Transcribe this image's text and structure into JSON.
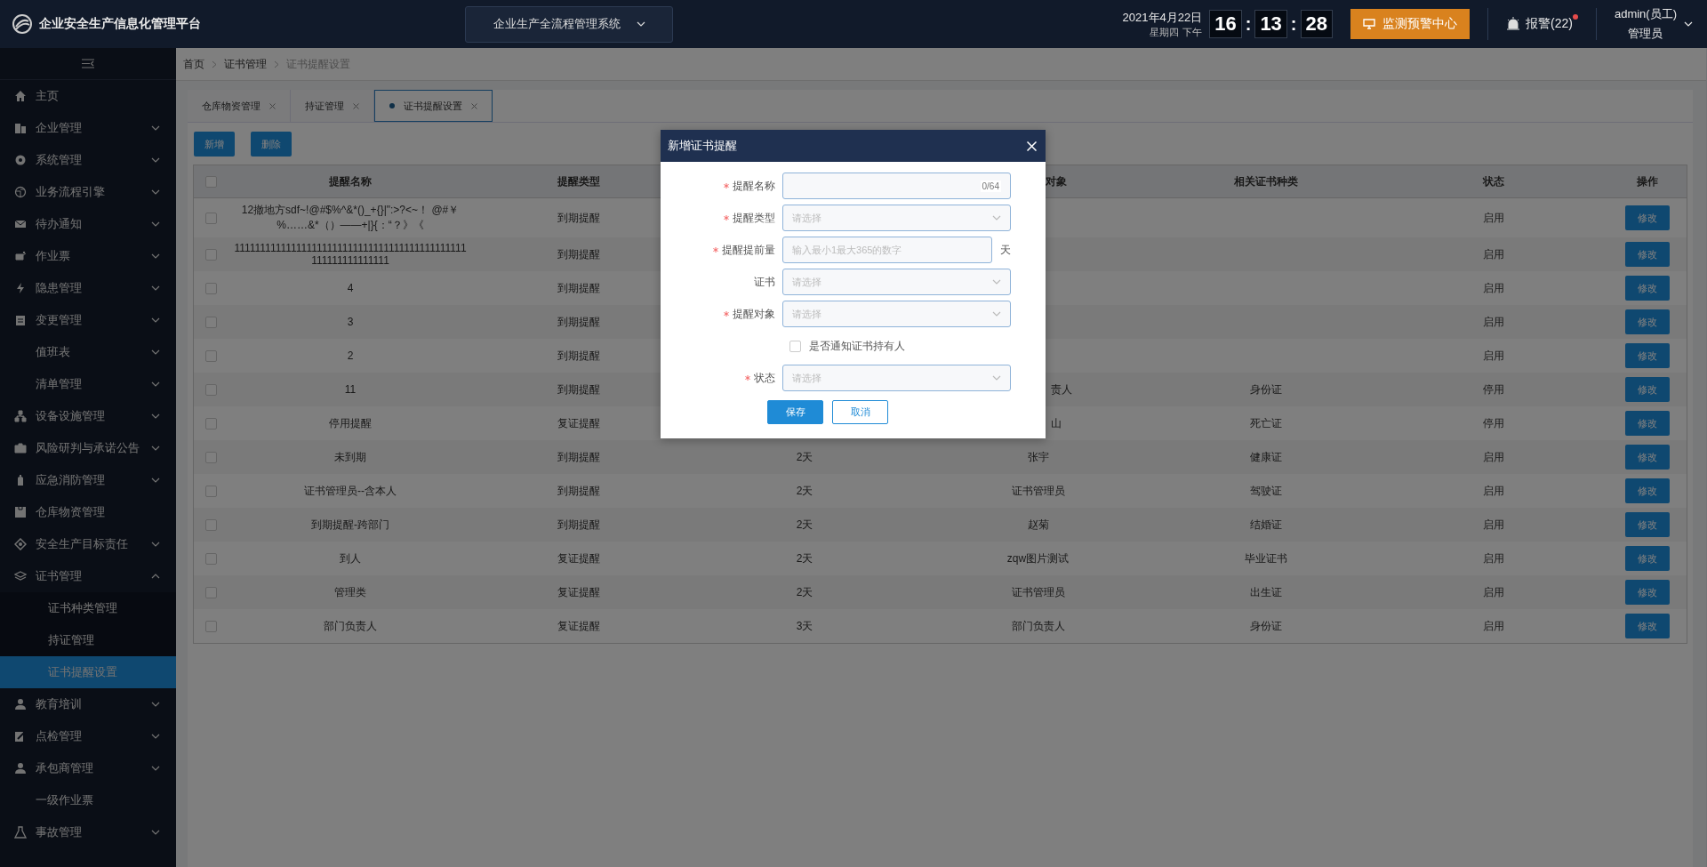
{
  "header": {
    "title": "企业安全生产信息化管理平台",
    "system": "企业生产全流程管理系统",
    "date": "2021年4月22日",
    "weekday": "星期四",
    "period": "下午",
    "time": [
      "16",
      "13",
      "28"
    ],
    "time_separators": [
      ":",
      ":"
    ],
    "monitor_button": "监测预警中心",
    "alarm": {
      "label": "报警(22)",
      "unread": true
    },
    "user": {
      "name": "admin(员工)",
      "role": "管理员"
    }
  },
  "sidebar": {
    "items": [
      {
        "label": "主页",
        "selected": false
      },
      {
        "label": "企业管理",
        "expanded": false,
        "selected": false
      },
      {
        "label": "系统管理",
        "expanded": false,
        "selected": false
      },
      {
        "label": "业务流程引擎",
        "expanded": false,
        "selected": false
      },
      {
        "label": "待办通知",
        "expanded": false,
        "selected": false
      },
      {
        "label": "作业票",
        "expanded": false,
        "selected": false
      },
      {
        "label": "隐患管理",
        "expanded": false,
        "selected": false
      },
      {
        "label": "变更管理",
        "expanded": false,
        "selected": false
      },
      {
        "label": "值班表",
        "expanded": false,
        "selected": false
      },
      {
        "label": "清单管理",
        "expanded": false,
        "selected": false
      },
      {
        "label": "设备设施管理",
        "expanded": false,
        "selected": false
      },
      {
        "label": "风险研判与承诺公告",
        "expanded": false,
        "selected": false
      },
      {
        "label": "应急消防管理",
        "expanded": false,
        "selected": false
      },
      {
        "label": "仓库物资管理",
        "selected": false
      },
      {
        "label": "安全生产目标责任",
        "expanded": false,
        "selected": false
      },
      {
        "label": "证书管理",
        "expanded": true,
        "selected": false,
        "children": [
          {
            "label": "证书种类管理",
            "selected": false
          },
          {
            "label": "持证管理",
            "selected": false
          },
          {
            "label": "证书提醒设置",
            "selected": true
          }
        ]
      },
      {
        "label": "教育培训",
        "expanded": false,
        "selected": false
      },
      {
        "label": "点检管理",
        "expanded": false,
        "selected": false
      },
      {
        "label": "承包商管理",
        "expanded": false,
        "selected": false
      },
      {
        "label": "一级作业票",
        "selected": false
      },
      {
        "label": "事故管理",
        "expanded": false,
        "selected": false
      }
    ]
  },
  "breadcrumb": [
    {
      "label": "首页",
      "current": false
    },
    {
      "label": "证书管理",
      "current": false
    },
    {
      "label": "证书提醒设置",
      "current": true
    }
  ],
  "tabs": [
    {
      "label": "仓库物资管理",
      "selected": false
    },
    {
      "label": "持证管理",
      "selected": false
    },
    {
      "label": "证书提醒设置",
      "selected": true
    }
  ],
  "toolbar": [
    "新增",
    "删除"
  ],
  "table": {
    "header_checked": false,
    "columns": [
      {
        "label": "提醒名称"
      },
      {
        "label": "提醒类型"
      },
      {
        "label": "对象",
        "partial": true
      },
      {
        "label": "相关证书种类"
      },
      {
        "label": "状态"
      },
      {
        "label": "操作"
      }
    ],
    "rows": [
      {
        "checked": false,
        "name": "12撤地方sdf~!@#$%^&*()_+{}|\":>?<~！ @#￥%……&*（）——+|}{：“？》《",
        "type": "到期提醒",
        "status": "启用",
        "action": "修改"
      },
      {
        "checked": false,
        "name": "111111111111111111111111111111111111111111111111111111111111",
        "type": "到期提醒",
        "status": "启用",
        "action": "修改"
      },
      {
        "checked": false,
        "name": "4",
        "type": "到期提醒",
        "status": "启用",
        "action": "修改"
      },
      {
        "checked": false,
        "name": "3",
        "type": "到期提醒",
        "status": "启用",
        "action": "修改"
      },
      {
        "checked": false,
        "name": "2",
        "type": "到期提醒",
        "status": "启用",
        "action": "修改"
      },
      {
        "checked": false,
        "name": "11",
        "type": "到期提醒",
        "object": "责人",
        "object_partial": true,
        "cert_kind": "身份证",
        "status": "停用",
        "action": "修改"
      },
      {
        "checked": false,
        "name": "停用提醒",
        "type": "复证提醒",
        "object": "山",
        "object_partial": true,
        "cert_kind": "死亡证",
        "status": "停用",
        "action": "修改"
      },
      {
        "checked": false,
        "name": "未到期",
        "type": "到期提醒",
        "lead": "2天",
        "object": "张宇",
        "cert_kind": "健康证",
        "status": "启用",
        "action": "修改"
      },
      {
        "checked": false,
        "name": "证书管理员--含本人",
        "type": "到期提醒",
        "lead": "2天",
        "object": "证书管理员",
        "cert_kind": "驾驶证",
        "status": "启用",
        "action": "修改"
      },
      {
        "checked": false,
        "name": "到期提醒-跨部门",
        "type": "到期提醒",
        "lead": "2天",
        "object": "赵菊",
        "cert_kind": "结婚证",
        "status": "启用",
        "action": "修改"
      },
      {
        "checked": false,
        "name": "到人",
        "type": "复证提醒",
        "lead": "2天",
        "object": "zqw图片测试",
        "cert_kind": "毕业证书",
        "status": "启用",
        "action": "修改"
      },
      {
        "checked": false,
        "name": "管理类",
        "type": "复证提醒",
        "lead": "2天",
        "object": "证书管理员",
        "cert_kind": "出生证",
        "status": "启用",
        "action": "修改"
      },
      {
        "checked": false,
        "name": "部门负责人",
        "type": "复证提醒",
        "lead": "3天",
        "object": "部门负责人",
        "cert_kind": "身份证",
        "status": "启用",
        "action": "修改"
      }
    ]
  },
  "dialog": {
    "title": "新增证书提醒",
    "fields": [
      {
        "kind": "text",
        "label": "提醒名称",
        "required": true,
        "counter": "0/64"
      },
      {
        "kind": "select",
        "label": "提醒类型",
        "required": true,
        "placeholder": "请选择"
      },
      {
        "kind": "number",
        "label": "提醒提前量",
        "required": true,
        "placeholder": "输入最小1最大365的数字",
        "suffix": "天"
      },
      {
        "kind": "select",
        "label": "证书",
        "required": false,
        "placeholder": "请选择"
      },
      {
        "kind": "select",
        "label": "提醒对象",
        "required": true,
        "placeholder": "请选择"
      },
      {
        "kind": "checkbox",
        "label": "是否通知证书持有人",
        "checked": false
      },
      {
        "kind": "select",
        "label": "状态",
        "required": true,
        "placeholder": "请选择"
      }
    ],
    "buttons": [
      {
        "label": "保存",
        "primary": true
      },
      {
        "label": "取消",
        "primary": false
      }
    ]
  }
}
